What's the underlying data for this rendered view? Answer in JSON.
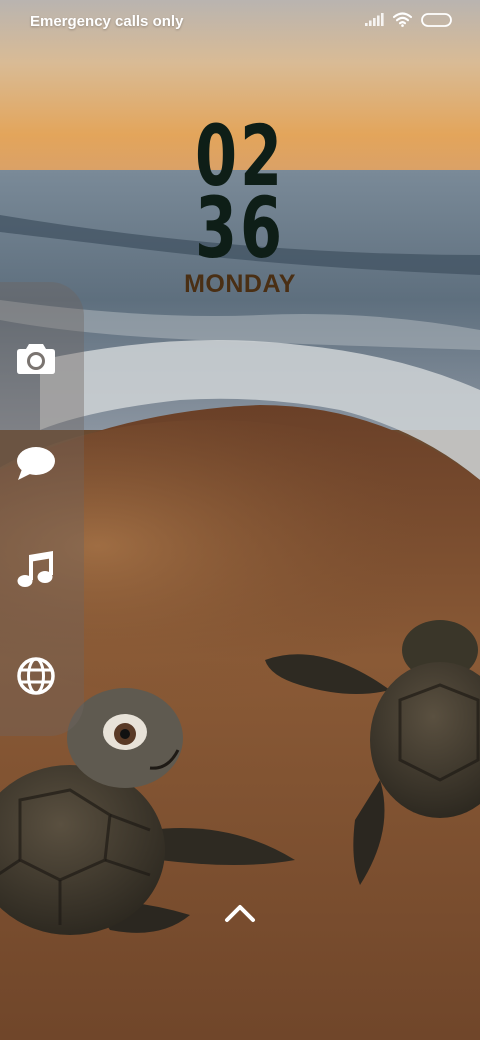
{
  "status_bar": {
    "carrier_text": "Emergency calls only",
    "icons": [
      "signal-icon",
      "wifi-icon",
      "battery-icon"
    ]
  },
  "clock": {
    "hours": "02",
    "minutes": "36",
    "day": "MONDAY",
    "digit_color": "#0e1e17",
    "day_color": "#4a2f14"
  },
  "shortcuts": [
    {
      "name": "camera-icon"
    },
    {
      "name": "message-icon"
    },
    {
      "name": "music-icon"
    },
    {
      "name": "globe-icon"
    }
  ],
  "unlock": {
    "icon": "chevron-up-icon"
  },
  "wallpaper": {
    "subject": "sea turtles on beach at sunset",
    "sky_color": "#e0a860",
    "sea_color": "#6c7f8e",
    "sand_color": "#7a4e2e"
  }
}
